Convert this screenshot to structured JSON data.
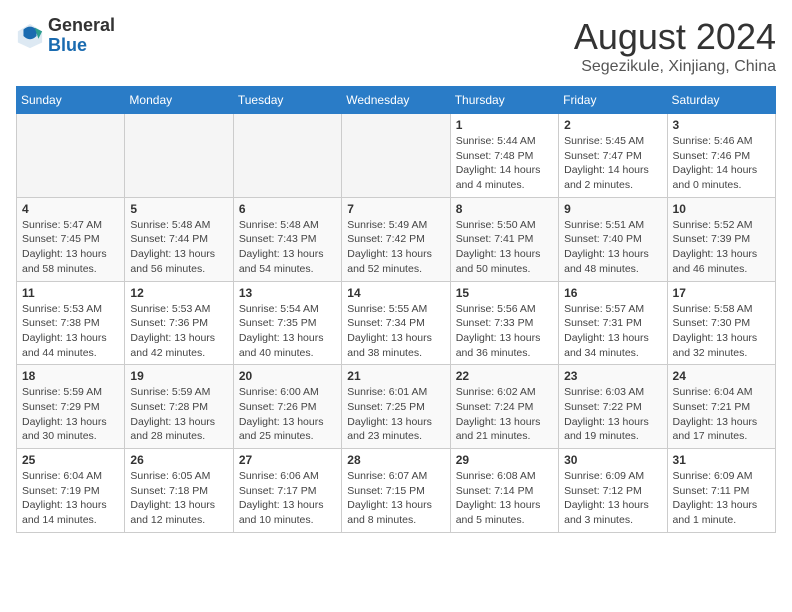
{
  "header": {
    "logo_line1": "General",
    "logo_line2": "Blue",
    "month_year": "August 2024",
    "location": "Segezikule, Xinjiang, China"
  },
  "days_of_week": [
    "Sunday",
    "Monday",
    "Tuesday",
    "Wednesday",
    "Thursday",
    "Friday",
    "Saturday"
  ],
  "weeks": [
    [
      {
        "day": "",
        "info": ""
      },
      {
        "day": "",
        "info": ""
      },
      {
        "day": "",
        "info": ""
      },
      {
        "day": "",
        "info": ""
      },
      {
        "day": "1",
        "info": "Sunrise: 5:44 AM\nSunset: 7:48 PM\nDaylight: 14 hours\nand 4 minutes."
      },
      {
        "day": "2",
        "info": "Sunrise: 5:45 AM\nSunset: 7:47 PM\nDaylight: 14 hours\nand 2 minutes."
      },
      {
        "day": "3",
        "info": "Sunrise: 5:46 AM\nSunset: 7:46 PM\nDaylight: 14 hours\nand 0 minutes."
      }
    ],
    [
      {
        "day": "4",
        "info": "Sunrise: 5:47 AM\nSunset: 7:45 PM\nDaylight: 13 hours\nand 58 minutes."
      },
      {
        "day": "5",
        "info": "Sunrise: 5:48 AM\nSunset: 7:44 PM\nDaylight: 13 hours\nand 56 minutes."
      },
      {
        "day": "6",
        "info": "Sunrise: 5:48 AM\nSunset: 7:43 PM\nDaylight: 13 hours\nand 54 minutes."
      },
      {
        "day": "7",
        "info": "Sunrise: 5:49 AM\nSunset: 7:42 PM\nDaylight: 13 hours\nand 52 minutes."
      },
      {
        "day": "8",
        "info": "Sunrise: 5:50 AM\nSunset: 7:41 PM\nDaylight: 13 hours\nand 50 minutes."
      },
      {
        "day": "9",
        "info": "Sunrise: 5:51 AM\nSunset: 7:40 PM\nDaylight: 13 hours\nand 48 minutes."
      },
      {
        "day": "10",
        "info": "Sunrise: 5:52 AM\nSunset: 7:39 PM\nDaylight: 13 hours\nand 46 minutes."
      }
    ],
    [
      {
        "day": "11",
        "info": "Sunrise: 5:53 AM\nSunset: 7:38 PM\nDaylight: 13 hours\nand 44 minutes."
      },
      {
        "day": "12",
        "info": "Sunrise: 5:53 AM\nSunset: 7:36 PM\nDaylight: 13 hours\nand 42 minutes."
      },
      {
        "day": "13",
        "info": "Sunrise: 5:54 AM\nSunset: 7:35 PM\nDaylight: 13 hours\nand 40 minutes."
      },
      {
        "day": "14",
        "info": "Sunrise: 5:55 AM\nSunset: 7:34 PM\nDaylight: 13 hours\nand 38 minutes."
      },
      {
        "day": "15",
        "info": "Sunrise: 5:56 AM\nSunset: 7:33 PM\nDaylight: 13 hours\nand 36 minutes."
      },
      {
        "day": "16",
        "info": "Sunrise: 5:57 AM\nSunset: 7:31 PM\nDaylight: 13 hours\nand 34 minutes."
      },
      {
        "day": "17",
        "info": "Sunrise: 5:58 AM\nSunset: 7:30 PM\nDaylight: 13 hours\nand 32 minutes."
      }
    ],
    [
      {
        "day": "18",
        "info": "Sunrise: 5:59 AM\nSunset: 7:29 PM\nDaylight: 13 hours\nand 30 minutes."
      },
      {
        "day": "19",
        "info": "Sunrise: 5:59 AM\nSunset: 7:28 PM\nDaylight: 13 hours\nand 28 minutes."
      },
      {
        "day": "20",
        "info": "Sunrise: 6:00 AM\nSunset: 7:26 PM\nDaylight: 13 hours\nand 25 minutes."
      },
      {
        "day": "21",
        "info": "Sunrise: 6:01 AM\nSunset: 7:25 PM\nDaylight: 13 hours\nand 23 minutes."
      },
      {
        "day": "22",
        "info": "Sunrise: 6:02 AM\nSunset: 7:24 PM\nDaylight: 13 hours\nand 21 minutes."
      },
      {
        "day": "23",
        "info": "Sunrise: 6:03 AM\nSunset: 7:22 PM\nDaylight: 13 hours\nand 19 minutes."
      },
      {
        "day": "24",
        "info": "Sunrise: 6:04 AM\nSunset: 7:21 PM\nDaylight: 13 hours\nand 17 minutes."
      }
    ],
    [
      {
        "day": "25",
        "info": "Sunrise: 6:04 AM\nSunset: 7:19 PM\nDaylight: 13 hours\nand 14 minutes."
      },
      {
        "day": "26",
        "info": "Sunrise: 6:05 AM\nSunset: 7:18 PM\nDaylight: 13 hours\nand 12 minutes."
      },
      {
        "day": "27",
        "info": "Sunrise: 6:06 AM\nSunset: 7:17 PM\nDaylight: 13 hours\nand 10 minutes."
      },
      {
        "day": "28",
        "info": "Sunrise: 6:07 AM\nSunset: 7:15 PM\nDaylight: 13 hours\nand 8 minutes."
      },
      {
        "day": "29",
        "info": "Sunrise: 6:08 AM\nSunset: 7:14 PM\nDaylight: 13 hours\nand 5 minutes."
      },
      {
        "day": "30",
        "info": "Sunrise: 6:09 AM\nSunset: 7:12 PM\nDaylight: 13 hours\nand 3 minutes."
      },
      {
        "day": "31",
        "info": "Sunrise: 6:09 AM\nSunset: 7:11 PM\nDaylight: 13 hours\nand 1 minute."
      }
    ]
  ]
}
